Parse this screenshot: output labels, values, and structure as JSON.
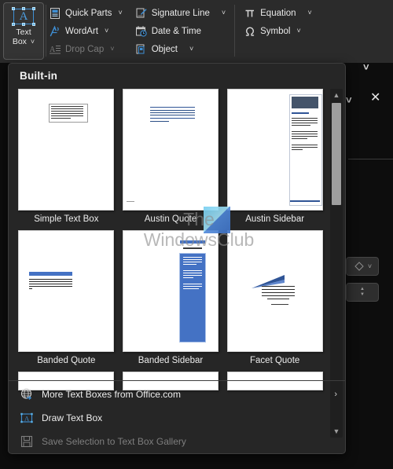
{
  "ribbon": {
    "textbox_button": {
      "name": "Text Box",
      "line1": "Text",
      "line2": "Box",
      "caret": "˅",
      "icon": "text-box-icon"
    },
    "groups": [
      {
        "name": "text-group",
        "items": [
          {
            "label": "Quick Parts",
            "icon": "quick-parts-icon",
            "caret": "˅",
            "disabled": false
          },
          {
            "label": "WordArt",
            "icon": "wordart-icon",
            "caret": "˅",
            "disabled": false
          },
          {
            "label": "Drop Cap",
            "icon": "drop-cap-icon",
            "caret": "˅",
            "disabled": true
          }
        ]
      },
      {
        "name": "insert-group",
        "items": [
          {
            "label": "Signature Line",
            "icon": "signature-line-icon",
            "caret": "˅",
            "disabled": false
          },
          {
            "label": "Date & Time",
            "icon": "date-time-icon",
            "caret": "",
            "disabled": false
          },
          {
            "label": "Object",
            "icon": "object-icon",
            "caret": "˅",
            "disabled": false
          }
        ]
      },
      {
        "name": "symbols-group",
        "items": [
          {
            "label": "Equation",
            "icon": "equation-pi-icon",
            "caret": "˅",
            "disabled": false
          },
          {
            "label": "Symbol",
            "icon": "symbol-omega-icon",
            "caret": "˅",
            "disabled": false
          }
        ]
      }
    ]
  },
  "gallery": {
    "heading": "Built-in",
    "scrollbar": {
      "up": "▲",
      "down": "▼"
    },
    "items": [
      {
        "label": "Simple Text Box",
        "style": "simple-text-box"
      },
      {
        "label": "Austin Quote",
        "style": "austin-quote"
      },
      {
        "label": "Austin Sidebar",
        "style": "austin-sidebar"
      },
      {
        "label": "Banded Quote",
        "style": "banded-quote"
      },
      {
        "label": "Banded Sidebar",
        "style": "banded-sidebar"
      },
      {
        "label": "Facet Quote",
        "style": "facet-quote"
      }
    ],
    "commands": [
      {
        "label": "More Text Boxes from Office.com",
        "mnemonic": "M",
        "icon": "globe-arrow-icon",
        "arrow": "›",
        "disabled": false
      },
      {
        "label": "Draw Text Box",
        "mnemonic": "D",
        "icon": "draw-text-box-icon",
        "arrow": "",
        "disabled": false
      },
      {
        "label": "Save Selection to Text Box Gallery",
        "mnemonic": "S",
        "icon": "save-floppy-icon",
        "arrow": "",
        "disabled": true
      }
    ]
  },
  "watermark": {
    "line1": "The",
    "line2": "WindowsClub"
  },
  "background": {
    "collapse_caret": "˅",
    "pane_caret": "˅",
    "close_x": "✕",
    "spinner_up": "▲",
    "spinner_down": "▼"
  },
  "colors": {
    "ribbon_bg": "#2b2b2b",
    "menu_bg": "#262626",
    "accent_blue": "#2f5496",
    "icon_blue": "#4d9ee0",
    "banded_blue": "#4472c4",
    "austin_dark": "#44546a",
    "text": "#ededed",
    "disabled_text": "#7e7e7e"
  }
}
